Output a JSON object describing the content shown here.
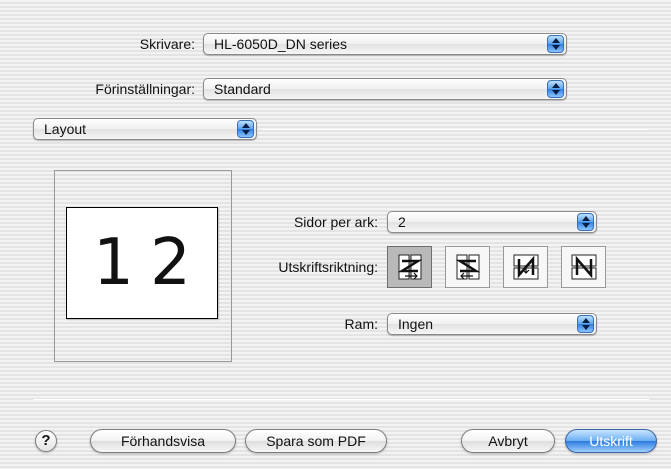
{
  "printer": {
    "label": "Skrivare:",
    "value": "HL-6050D_DN series"
  },
  "presets": {
    "label": "Förinställningar:",
    "value": "Standard"
  },
  "panel": {
    "value": "Layout"
  },
  "preview": {
    "left_number": "1",
    "right_number": "2"
  },
  "pages_per_sheet": {
    "label": "Sidor per ark:",
    "value": "2"
  },
  "layout_direction": {
    "label": "Utskriftsriktning:",
    "options": [
      "z-icon",
      "reverse-z-icon",
      "n-reverse-icon",
      "n-icon"
    ],
    "selected_index": 0
  },
  "border": {
    "label": "Ram:",
    "value": "Ingen"
  },
  "buttons": {
    "help": "?",
    "preview": "Förhandsvisa",
    "save_pdf": "Spara som PDF",
    "cancel": "Avbryt",
    "print": "Utskrift"
  },
  "colors": {
    "accent": "#2d7be0",
    "selected_option": "#b9b9b9"
  }
}
